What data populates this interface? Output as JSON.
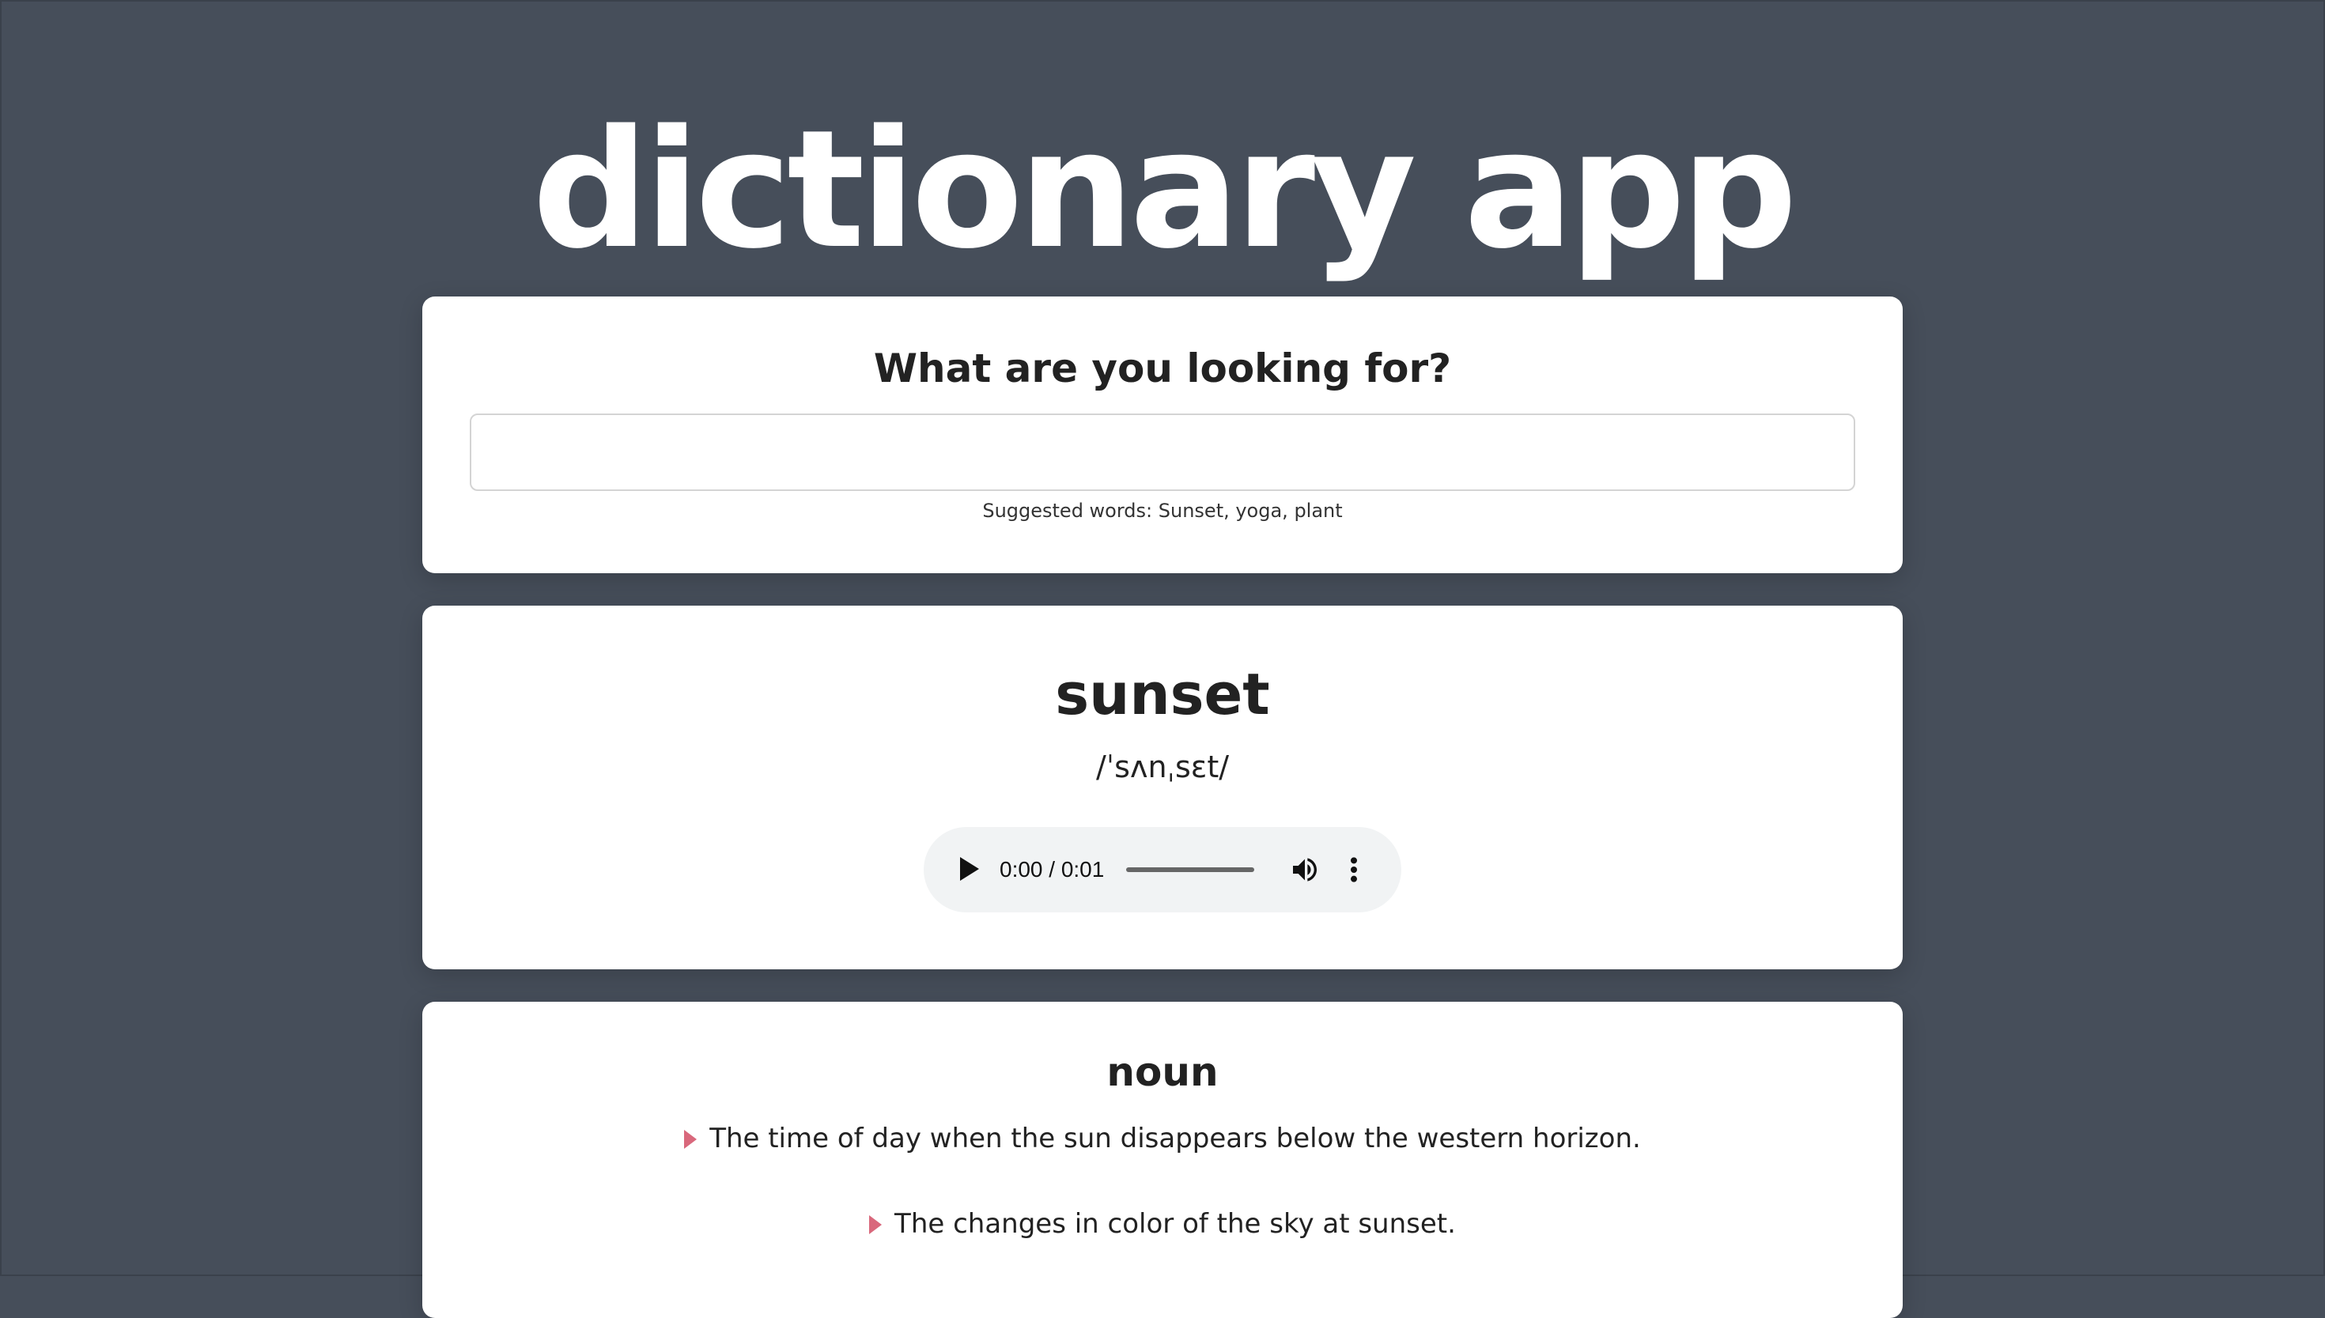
{
  "app": {
    "title": "dictionary app"
  },
  "search": {
    "heading": "What are you looking for?",
    "value": "",
    "placeholder": "",
    "suggested_text": "Suggested words: Sunset, yoga, plant"
  },
  "entry": {
    "word": "sunset",
    "phonetic": "/ˈsʌnˌsɛt/",
    "audio": {
      "time_display": "0:00 / 0:01",
      "progress": 0
    }
  },
  "meanings": [
    {
      "part_of_speech": "noun",
      "definitions": [
        "The time of day when the sun disappears below the western horizon.",
        "The changes in color of the sky at sunset."
      ]
    }
  ],
  "colors": {
    "background": "#464e5a",
    "card": "#ffffff",
    "bullet_accent": "#d9687c",
    "audio_player": "#f1f3f4"
  },
  "icons": {
    "play": "play-icon",
    "volume": "volume-icon",
    "menu": "more-vertical-icon",
    "bullet": "triangle-bullet-icon"
  }
}
